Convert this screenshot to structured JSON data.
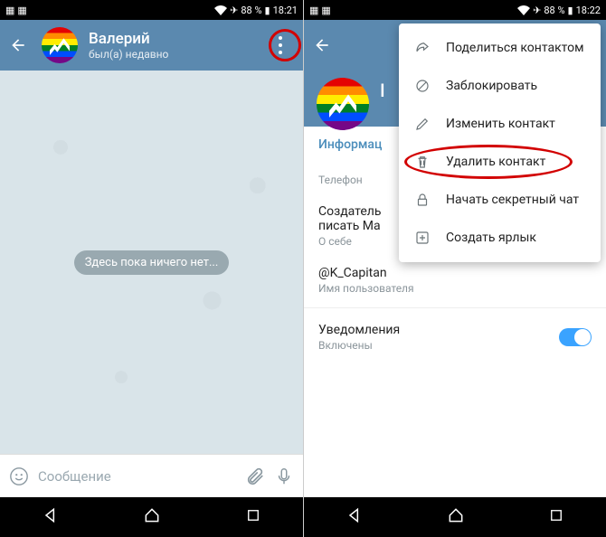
{
  "statusbar": {
    "battery": "88 %",
    "time_left": "18:21",
    "time_right": "18:22"
  },
  "left": {
    "contact_name": "Валерий",
    "last_seen": "был(а) недавно",
    "empty_text": "Здесь пока ничего нет...",
    "input_placeholder": "Сообщение"
  },
  "right": {
    "partial_name": "I",
    "info_label": "Информац",
    "phone_label": "Телефон",
    "about_text": "Создатель\nписать Ма",
    "about_label": "О себе",
    "username": "@K_Capitan",
    "username_label": "Имя пользователя",
    "notif_title": "Уведомления",
    "notif_status": "Включены"
  },
  "menu": {
    "share": "Поделиться контактом",
    "block": "Заблокировать",
    "edit": "Изменить контакт",
    "delete": "Удалить контакт",
    "secret": "Начать секретный чат",
    "shortcut": "Создать ярлык"
  }
}
